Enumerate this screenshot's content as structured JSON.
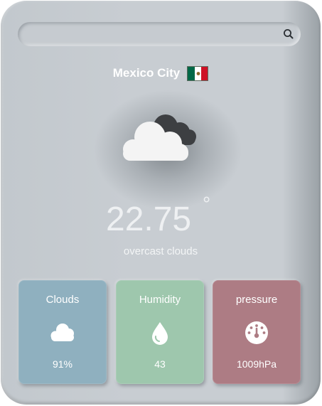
{
  "search": {
    "value": "",
    "placeholder": "",
    "icon": "search-icon"
  },
  "location": {
    "city": "Mexico City",
    "flag_icon": "mexico-flag-icon",
    "flag_colors": [
      "#006847",
      "#ffffff",
      "#ce1126"
    ]
  },
  "current": {
    "icon": "overcast-clouds-icon",
    "temperature": "22.75",
    "degree_symbol": "°",
    "description": "overcast clouds"
  },
  "tiles": [
    {
      "title": "Clouds",
      "value": "91%",
      "icon": "cloud-icon",
      "color": "#8fb0bf"
    },
    {
      "title": "Humidity",
      "value": "43",
      "icon": "water-drop-icon",
      "color": "#9ec7ad"
    },
    {
      "title": "pressure",
      "value": "1009hPa",
      "icon": "gauge-icon",
      "color": "#ad7c84"
    }
  ]
}
